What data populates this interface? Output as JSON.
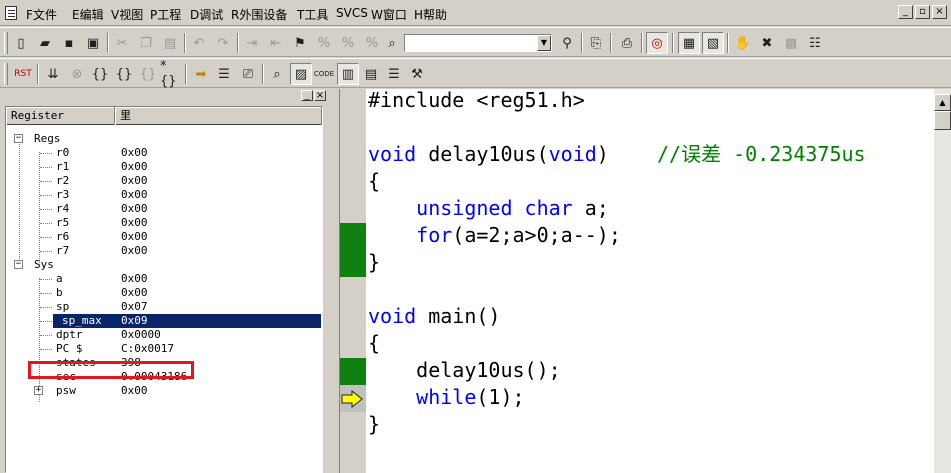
{
  "menu": [
    "F文件",
    "E编辑",
    "V视图",
    "P工程",
    "D调试",
    "R外围设备",
    "T工具",
    "SVCS",
    "W窗口",
    "H帮助"
  ],
  "window_controls": [
    "_",
    "▫",
    "×"
  ],
  "panel_controls": [
    "_",
    "×"
  ],
  "toolbar1_icons": [
    "new-file-icon",
    "open-folder-icon",
    "save-icon",
    "save-all-icon",
    "cut-icon",
    "copy-icon",
    "paste-icon",
    "undo-icon",
    "redo-icon",
    "indent-icon",
    "unindent-icon",
    "bookmark-toggle-icon",
    "bookmark-prev-icon",
    "bookmark-next-icon",
    "bookmark-clear-icon",
    "find-in-files-icon",
    "find-icon",
    "incremental-find-icon",
    "print-icon",
    "debug-session-icon",
    "project-window-icon",
    "output-window-icon",
    "hand-icon",
    "breakpoint-icon",
    "tools-icon",
    "configure-icon"
  ],
  "find_combo": {
    "value": ""
  },
  "toolbar2_icons": [
    "reset-cpu-icon",
    "run-icon",
    "stop-icon",
    "step-into-icon",
    "step-over-icon",
    "step-out-icon",
    "run-to-cursor-icon",
    "show-next-statement-icon",
    "disassembly-icon",
    "watch-icon",
    "command-window-icon",
    "code-coverage-icon",
    "serial-window-icon",
    "memory-window-icon",
    "performance-icon",
    "logic-analyzer-icon"
  ],
  "register_panel": {
    "columns": [
      "Register",
      "里"
    ],
    "groups": [
      {
        "name": "Regs",
        "expander": "−"
      },
      {
        "name": "Sys",
        "expander": "−"
      }
    ],
    "regs": [
      {
        "name": "r0",
        "value": "0x00"
      },
      {
        "name": "r1",
        "value": "0x00"
      },
      {
        "name": "r2",
        "value": "0x00"
      },
      {
        "name": "r3",
        "value": "0x00"
      },
      {
        "name": "r4",
        "value": "0x00"
      },
      {
        "name": "r5",
        "value": "0x00"
      },
      {
        "name": "r6",
        "value": "0x00"
      },
      {
        "name": "r7",
        "value": "0x00"
      }
    ],
    "sys": [
      {
        "name": "a",
        "value": "0x00"
      },
      {
        "name": "b",
        "value": "0x00"
      },
      {
        "name": "sp",
        "value": "0x07"
      },
      {
        "name": "sp_max",
        "value": "0x09",
        "selected": true
      },
      {
        "name": "dptr",
        "value": "0x0000"
      },
      {
        "name": "PC  $",
        "value": "C:0x0017"
      },
      {
        "name": "states",
        "value": "398"
      },
      {
        "name": "sec",
        "value": "0.00043186",
        "highlight_color": "#e5161e"
      },
      {
        "name": "psw",
        "value": "0x00",
        "expander": "+"
      }
    ]
  },
  "editor": {
    "lines": [
      [
        {
          "t": "#include <reg51.h>",
          "c": ""
        }
      ],
      [],
      [
        {
          "t": "void",
          "c": "kw"
        },
        {
          "t": " delay10us(",
          "c": ""
        },
        {
          "t": "void",
          "c": "kw"
        },
        {
          "t": ")    ",
          "c": ""
        },
        {
          "t": "//误差 -0.234375us",
          "c": "cm"
        }
      ],
      [
        {
          "t": "{",
          "c": ""
        }
      ],
      [
        {
          "t": "    ",
          "c": ""
        },
        {
          "t": "unsigned",
          "c": "kw"
        },
        {
          "t": " ",
          "c": ""
        },
        {
          "t": "char",
          "c": "kw"
        },
        {
          "t": " a;",
          "c": ""
        }
      ],
      [
        {
          "t": "    ",
          "c": ""
        },
        {
          "t": "for",
          "c": "kw"
        },
        {
          "t": "(a=2;a>0;a--);",
          "c": ""
        }
      ],
      [
        {
          "t": "}",
          "c": ""
        }
      ],
      [],
      [
        {
          "t": "void",
          "c": "kw"
        },
        {
          "t": " main()",
          "c": ""
        }
      ],
      [
        {
          "t": "{",
          "c": ""
        }
      ],
      [
        {
          "t": "    delay10us();",
          "c": ""
        }
      ],
      [
        {
          "t": "    ",
          "c": ""
        },
        {
          "t": "while",
          "c": "kw"
        },
        {
          "t": "(1);",
          "c": ""
        }
      ],
      [
        {
          "t": "}",
          "c": ""
        }
      ]
    ],
    "colors": {
      "keyword": "#0000ff",
      "comment": "#008000",
      "coverage_mark": "#108010",
      "current_line_arrow": "#ffff00"
    }
  }
}
